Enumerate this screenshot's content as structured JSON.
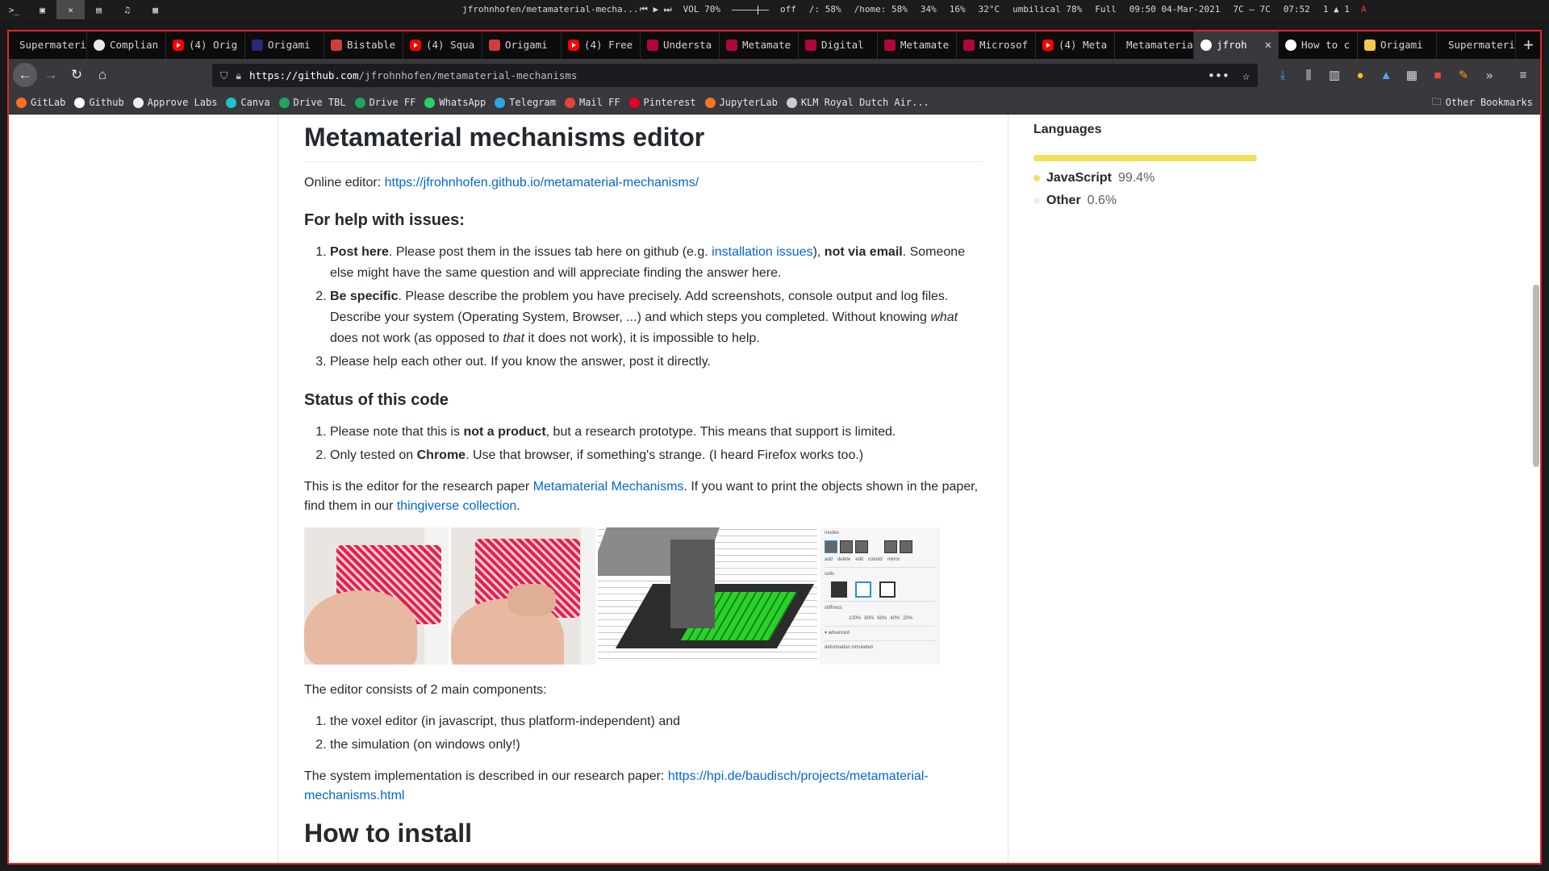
{
  "system_bar": {
    "workspaces": [
      ">_",
      "▣",
      "✕",
      "▤",
      "♫",
      "▦"
    ],
    "window_title": "jfrohnhofen/metamaterial-mecha...",
    "media": [
      "⏮",
      "▶",
      "⏭"
    ],
    "volume": "VOL 70%",
    "status": [
      "off",
      "/: 58%",
      "/home: 58%",
      "34%",
      "16%",
      "32°C",
      "umbilical 78%",
      "Full",
      "09:50 04-Mar-2021",
      "7C — 7C",
      "07:52",
      "1 ▲ 1"
    ],
    "alert_icon": "A"
  },
  "tabs": [
    {
      "label": "Supermateria",
      "icon": "none"
    },
    {
      "label": "Complian",
      "icon": "ring"
    },
    {
      "label": "(4) Orig",
      "icon": "youtube"
    },
    {
      "label": "Origami",
      "icon": "origami"
    },
    {
      "label": "Bistable",
      "icon": "bistable"
    },
    {
      "label": "(4) Squa",
      "icon": "youtube"
    },
    {
      "label": "Origami",
      "icon": "bistable"
    },
    {
      "label": "(4) Free",
      "icon": "youtube"
    },
    {
      "label": "Understa",
      "icon": "hpi"
    },
    {
      "label": "Metamate",
      "icon": "hpi"
    },
    {
      "label": "Digital",
      "icon": "hpi"
    },
    {
      "label": "Metamate",
      "icon": "hpi"
    },
    {
      "label": "Microsof",
      "icon": "hpi"
    },
    {
      "label": "(4) Meta",
      "icon": "youtube"
    },
    {
      "label": "Metamaterial",
      "icon": "none"
    },
    {
      "label": "jfroh",
      "icon": "github",
      "active": true
    },
    {
      "label": "How to c",
      "icon": "github"
    },
    {
      "label": "Origami",
      "icon": "yellow"
    },
    {
      "label": "Supermateria",
      "icon": "none"
    }
  ],
  "navbar": {
    "url_host": "https://github.com",
    "url_path": "/jfrohnhofen/metamaterial-mechanisms",
    "more": "•••",
    "star": "☆"
  },
  "bookmarks": [
    {
      "label": "GitLab",
      "color": "#fc6d26"
    },
    {
      "label": "Github",
      "color": "#ffffff"
    },
    {
      "label": "Approve Labs",
      "color": "#eeeeee"
    },
    {
      "label": "Canva",
      "color": "#20c4cb"
    },
    {
      "label": "Drive TBL",
      "color": "#1fa463"
    },
    {
      "label": "Drive FF",
      "color": "#1fa463"
    },
    {
      "label": "WhatsApp",
      "color": "#25d366"
    },
    {
      "label": "Telegram",
      "color": "#2ca5e0"
    },
    {
      "label": "Mail FF",
      "color": "#ea4335"
    },
    {
      "label": "Pinterest",
      "color": "#e60023"
    },
    {
      "label": "JupyterLab",
      "color": "#f37726"
    },
    {
      "label": "KLM Royal Dutch Air...",
      "color": "#cccccc"
    }
  ],
  "other_bookmarks": "Other Bookmarks",
  "readme": {
    "title": "Metamaterial mechanisms editor",
    "online_label": "Online editor: ",
    "online_link": "https://jfrohnhofen.github.io/metamaterial-mechanisms/",
    "help_heading": "For help with issues:",
    "help_items": [
      {
        "bold": "Post here",
        "text1": ". Please post them in the issues tab here on github (e.g. ",
        "link": "installation issues",
        "text2": "), ",
        "bold2": "not via email",
        "text3": ". Someone else might have the same question and will appreciate finding the answer here."
      },
      {
        "bold": "Be specific",
        "text1": ". Please describe the problem you have precisely. Add screenshots, console output and log files. Describe your system (Operating System, Browser, ...) and which steps you completed. Without knowing ",
        "em1": "what",
        "text2": " does not work (as opposed to ",
        "em2": "that",
        "text3": " it does not work), it is impossible to help."
      },
      {
        "text": "Please help each other out. If you know the answer, post it directly."
      }
    ],
    "status_heading": "Status of this code",
    "status_items": [
      {
        "text1": "Please note that this is ",
        "bold": "not a product",
        "text2": ", but a research prototype. This means that support is limited."
      },
      {
        "text1": "Only tested on ",
        "bold": "Chrome",
        "text2": ". Use that browser, if something's strange. (I heard Firefox works too.)"
      }
    ],
    "paper_text1": "This is the editor for the research paper ",
    "paper_link": "Metamaterial Mechanisms",
    "paper_text2": ". If you want to print the objects shown in the paper, find them in our ",
    "thingiverse_link": "thingiverse collection",
    "paper_text3": ".",
    "figure_panel": {
      "modes_label": "modes",
      "mode_buttons": [
        "add",
        "delete",
        "edit",
        "cuboid",
        "mirror"
      ],
      "cells_label": "cells",
      "stiffness_label": "stiffness",
      "stiffness_values": [
        "100%",
        "80%",
        "60%",
        "40%",
        "20%"
      ],
      "advanced_label": "▾ advanced",
      "simulation_label": "deformation simulation"
    },
    "components_intro": "The editor consists of 2 main components:",
    "components": [
      "the voxel editor (in javascript, thus platform-independent) and",
      "the simulation (on windows only!)"
    ],
    "impl_text": "The system implementation is described in our research paper: ",
    "impl_link": "https://hpi.de/baudisch/projects/metamaterial-mechanisms.html",
    "install_heading": "How to install"
  },
  "sidebar": {
    "languages_heading": "Languages",
    "languages": [
      {
        "name": "JavaScript",
        "percent": "99.4%",
        "fraction": 0.994,
        "color": "#f1e05a"
      },
      {
        "name": "Other",
        "percent": "0.6%",
        "fraction": 0.006,
        "color": "#ededed"
      }
    ]
  },
  "colors": {
    "link": "#0366d6",
    "text": "#24292e",
    "frame_border": "#e0262a"
  }
}
